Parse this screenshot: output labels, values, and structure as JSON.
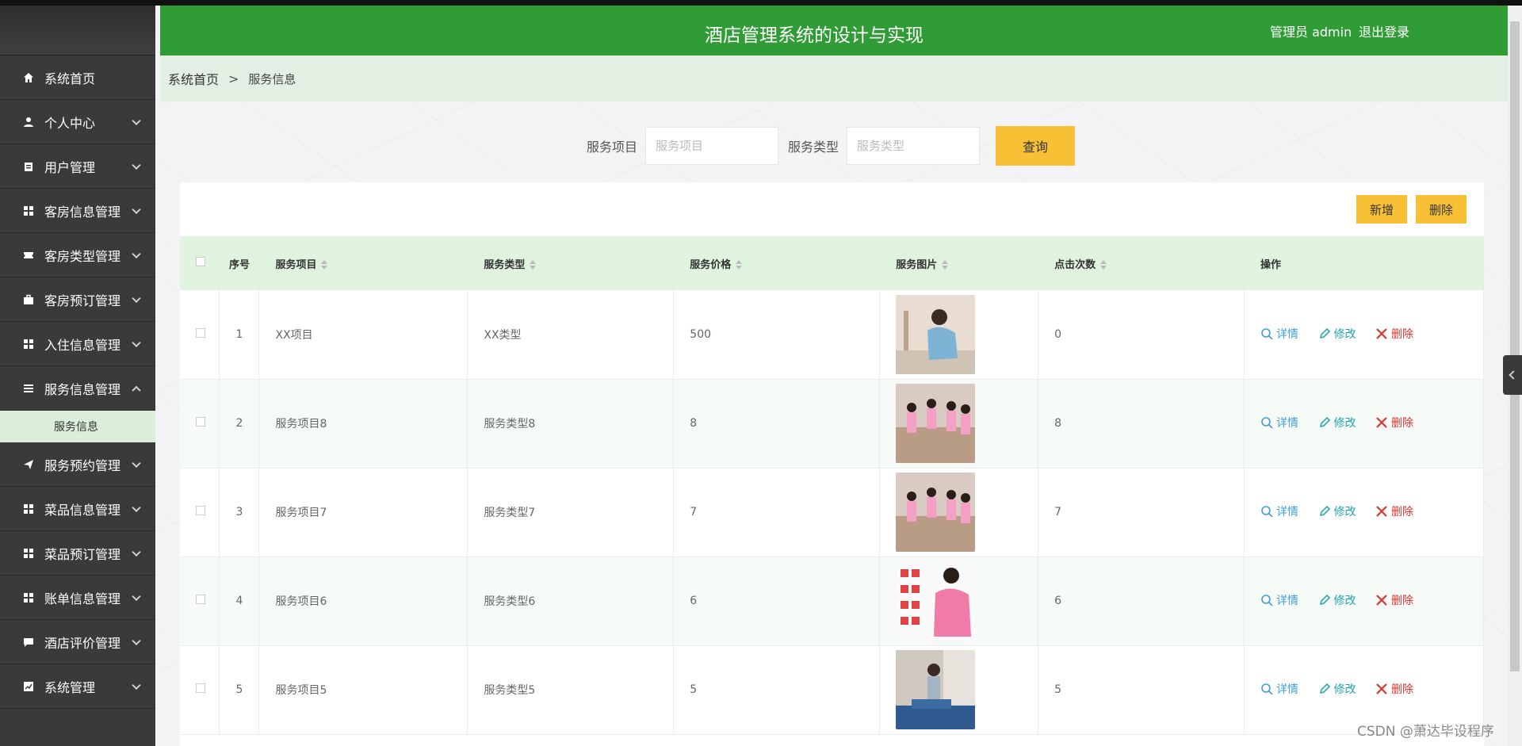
{
  "header": {
    "title": "酒店管理系统的设计与实现",
    "user": "管理员 admin",
    "logout": "退出登录"
  },
  "breadcrumb": {
    "home": "系统首页",
    "sep": ">",
    "current": "服务信息"
  },
  "sidebar": {
    "items": [
      {
        "label": "系统首页",
        "icon": "home-icon"
      },
      {
        "label": "个人中心",
        "icon": "user-icon"
      },
      {
        "label": "用户管理",
        "icon": "clipboard-icon"
      },
      {
        "label": "客房信息管理",
        "icon": "grid-icon"
      },
      {
        "label": "客房类型管理",
        "icon": "ticket-icon"
      },
      {
        "label": "客房预订管理",
        "icon": "briefcase-icon"
      },
      {
        "label": "入住信息管理",
        "icon": "grid-icon"
      },
      {
        "label": "服务信息管理",
        "icon": "list-icon"
      },
      {
        "label": "服务预约管理",
        "icon": "send-icon"
      },
      {
        "label": "菜品信息管理",
        "icon": "grid-icon"
      },
      {
        "label": "菜品预订管理",
        "icon": "grid-icon"
      },
      {
        "label": "账单信息管理",
        "icon": "grid-icon"
      },
      {
        "label": "酒店评价管理",
        "icon": "comment-icon"
      },
      {
        "label": "系统管理",
        "icon": "chart-icon"
      }
    ],
    "submenu": "服务信息"
  },
  "search": {
    "label1": "服务项目",
    "placeholder1": "服务项目",
    "label2": "服务类型",
    "placeholder2": "服务类型",
    "query": "查询"
  },
  "actions": {
    "add": "新增",
    "delete": "删除"
  },
  "table": {
    "headers": {
      "index": "序号",
      "item": "服务项目",
      "type": "服务类型",
      "price": "服务价格",
      "image": "服务图片",
      "clicks": "点击次数",
      "ops": "操作"
    },
    "op_labels": {
      "detail": "详情",
      "edit": "修改",
      "remove": "删除"
    },
    "rows": [
      {
        "index": "1",
        "item": "XX项目",
        "type": "XX类型",
        "price": "500",
        "clicks": "0"
      },
      {
        "index": "2",
        "item": "服务项目8",
        "type": "服务类型8",
        "price": "8",
        "clicks": "8"
      },
      {
        "index": "3",
        "item": "服务项目7",
        "type": "服务类型7",
        "price": "7",
        "clicks": "7"
      },
      {
        "index": "4",
        "item": "服务项目6",
        "type": "服务类型6",
        "price": "6",
        "clicks": "6"
      },
      {
        "index": "5",
        "item": "服务项目5",
        "type": "服务类型5",
        "price": "5",
        "clicks": "5"
      }
    ]
  },
  "watermark": "CSDN @萧达毕设程序",
  "colors": {
    "header": "#2f9c36",
    "sidebar": "#3a3a3c",
    "accent": "#f7c035"
  }
}
